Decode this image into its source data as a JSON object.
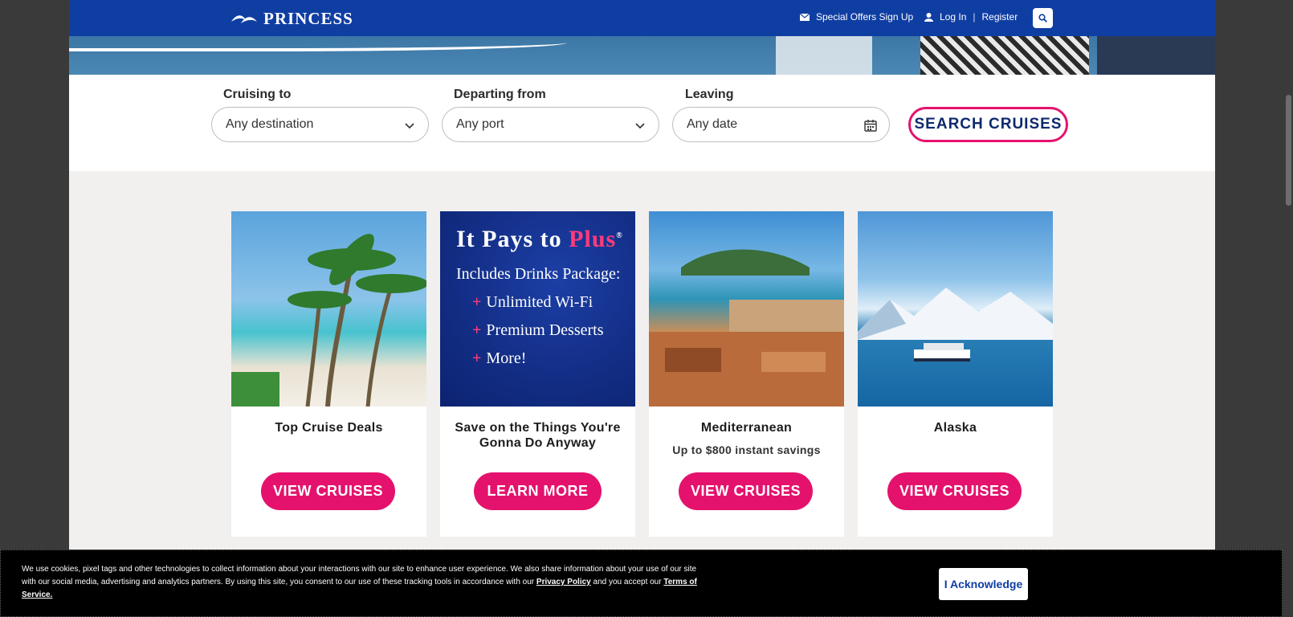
{
  "brand": {
    "name": "PRINCESS"
  },
  "header": {
    "offers_label": "Special Offers Sign Up",
    "login_label": "Log In",
    "separator": "|",
    "register_label": "Register"
  },
  "finder": {
    "cruising_to": {
      "label": "Cruising to",
      "value": "Any destination"
    },
    "departing_from": {
      "label": "Departing from",
      "value": "Any port"
    },
    "leaving": {
      "label": "Leaving",
      "value": "Any date"
    },
    "search_label": "SEARCH CRUISES"
  },
  "cards": [
    {
      "title": "Top Cruise Deals",
      "subtitle": "",
      "cta": "VIEW CRUISES"
    },
    {
      "title": "Save on the Things You're Gonna Do Anyway",
      "subtitle": "",
      "cta": "LEARN MORE",
      "promo": {
        "headline_prefix": "It Pays to",
        "headline_accent": "Plus",
        "registered": "®",
        "line": "Includes Drinks Package:",
        "bullets": [
          "Unlimited Wi-Fi",
          "Premium Desserts",
          "More!"
        ]
      }
    },
    {
      "title": "Mediterranean",
      "subtitle": "Up to $800 instant savings",
      "cta": "VIEW CRUISES"
    },
    {
      "title": "Alaska",
      "subtitle": "",
      "cta": "VIEW CRUISES"
    }
  ],
  "cookie": {
    "text": "We use cookies, pixel tags and other technologies to collect information about your interactions with our site to enhance user experience. We also share information about your use of our site with our social media, advertising and analytics partners. By using this site, you consent to our use of these tracking tools in accordance with our",
    "privacy_label": "Privacy Policy",
    "middle": "and you accept our",
    "terms_label": "Terms of Service.",
    "ack_label": "I Acknowledge"
  },
  "colors": {
    "brand_blue": "#0f3ea3",
    "accent_pink": "#e5126d"
  }
}
